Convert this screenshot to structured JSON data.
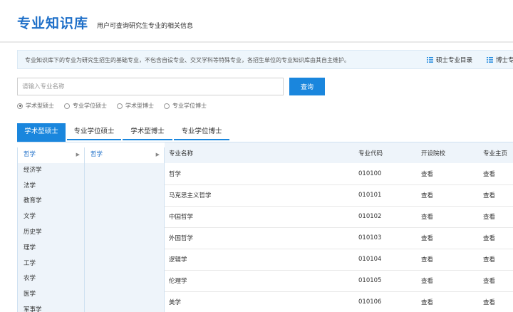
{
  "header": {
    "title": "专业知识库",
    "subtitle": "用户可查询研究生专业的相关信息"
  },
  "notice": {
    "text": "专业知识库下的专业为研究生招生的基础专业，不包含自设专业、交叉学科等特殊专业，各招生单位的专业知识库由其自主维护。",
    "links": [
      {
        "label": "硕士专业目录",
        "icon": "list-icon"
      },
      {
        "label": "博士专",
        "icon": "list-icon"
      }
    ]
  },
  "search": {
    "placeholder": "请输入专业名称",
    "button": "查询"
  },
  "radios": [
    {
      "label": "学术型硕士",
      "checked": true
    },
    {
      "label": "专业学位硕士",
      "checked": false
    },
    {
      "label": "学术型博士",
      "checked": false
    },
    {
      "label": "专业学位博士",
      "checked": false
    }
  ],
  "tabs": [
    "学术型硕士",
    "专业学位硕士",
    "学术型博士",
    "专业学位博士"
  ],
  "categories": [
    "哲学",
    "经济学",
    "法学",
    "教育学",
    "文学",
    "历史学",
    "理学",
    "工学",
    "农学",
    "医学",
    "军事学"
  ],
  "subcategories": [
    "哲学"
  ],
  "table": {
    "headers": [
      "专业名称",
      "专业代码",
      "开设院校",
      "专业主页"
    ],
    "rows": [
      {
        "name": "哲学",
        "code": "010100",
        "schools": "查看",
        "home": "查看"
      },
      {
        "name": "马克思主义哲学",
        "code": "010101",
        "schools": "查看",
        "home": "查看"
      },
      {
        "name": "中国哲学",
        "code": "010102",
        "schools": "查看",
        "home": "查看"
      },
      {
        "name": "外国哲学",
        "code": "010103",
        "schools": "查看",
        "home": "查看"
      },
      {
        "name": "逻辑学",
        "code": "010104",
        "schools": "查看",
        "home": "查看"
      },
      {
        "name": "伦理学",
        "code": "010105",
        "schools": "查看",
        "home": "查看"
      },
      {
        "name": "美学",
        "code": "010106",
        "schools": "查看",
        "home": "查看"
      }
    ]
  },
  "colors": {
    "primary": "#1a86dd",
    "title": "#1e6fc8",
    "panel": "#eef4fa"
  }
}
